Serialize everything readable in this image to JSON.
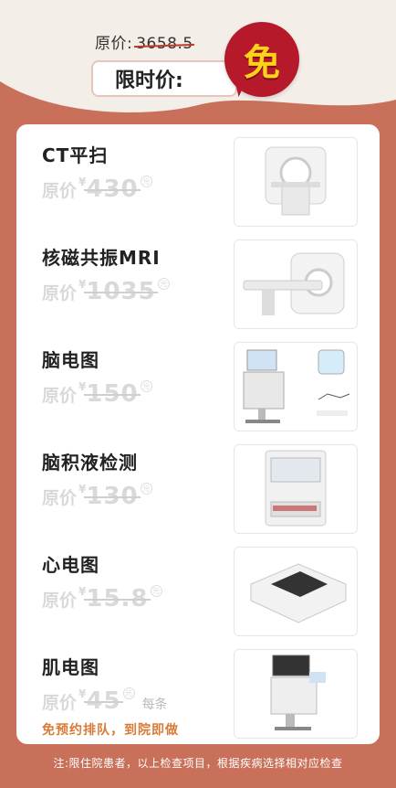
{
  "header": {
    "original_total_label": "原价:",
    "original_total_value": "3658.5",
    "limited_price_label": "限时价:",
    "free_badge": "免"
  },
  "items": [
    {
      "name": "CT平扫",
      "price_label": "原价",
      "currency": "¥",
      "price": "430",
      "unit": "元",
      "image_icon": "ct-scanner-icon"
    },
    {
      "name": "核磁共振MRI",
      "price_label": "原价",
      "currency": "¥",
      "price": "1035",
      "unit": "元",
      "image_icon": "mri-machine-icon"
    },
    {
      "name": "脑电图",
      "price_label": "原价",
      "currency": "¥",
      "price": "150",
      "unit": "元",
      "image_icon": "eeg-machine-icon"
    },
    {
      "name": "脑积液检测",
      "price_label": "原价",
      "currency": "¥",
      "price": "130",
      "unit": "元",
      "image_icon": "csf-analyzer-icon"
    },
    {
      "name": "心电图",
      "price_label": "原价",
      "currency": "¥",
      "price": "15.8",
      "unit": "元",
      "image_icon": "ecg-machine-icon"
    },
    {
      "name": "肌电图",
      "price_label": "原价",
      "currency": "¥",
      "price": "45",
      "unit": "元",
      "per": "每条",
      "image_icon": "emg-machine-icon"
    }
  ],
  "promo_note": "免预约排队，到院即做",
  "footer_note": "注:限住院患者，以上检查项目，根据疾病选择相对应检查",
  "colors": {
    "background": "#c9705a",
    "badge": "#b5192a",
    "badge_text": "#ffd21a",
    "promo": "#d97b36"
  }
}
